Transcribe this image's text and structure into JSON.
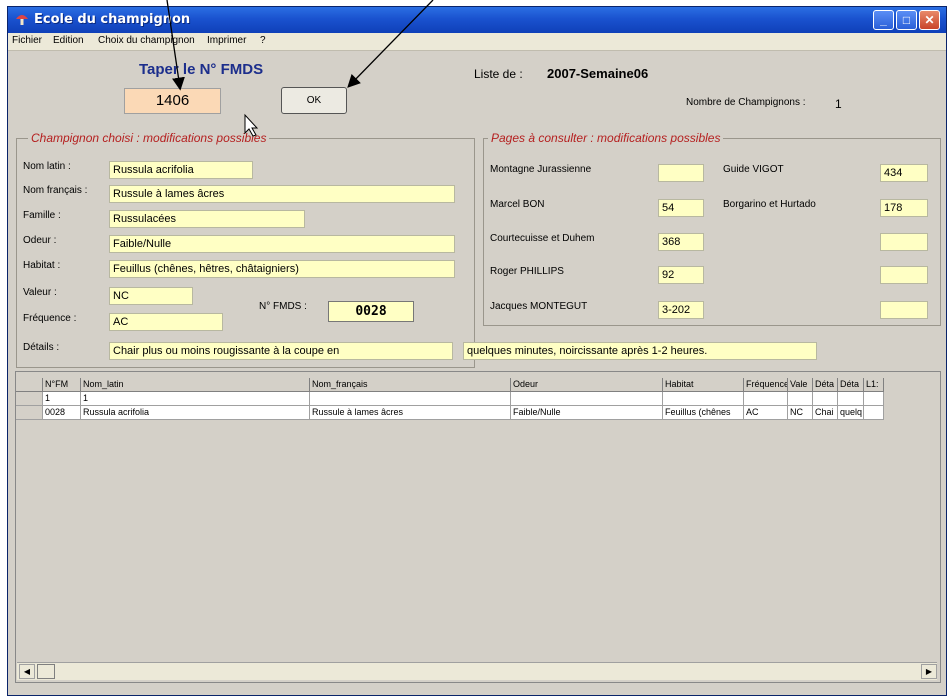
{
  "window": {
    "title": "Ecole du champignon"
  },
  "menu": [
    "Fichier",
    "Edition",
    "Choix du champignon",
    "Imprimer",
    "?"
  ],
  "search": {
    "label": "Taper le N° FMDS",
    "value": "1406",
    "ok": "OK"
  },
  "liste": {
    "label": "Liste de :",
    "value": "2007-Semaine06"
  },
  "count": {
    "label": "Nombre de Champignons :",
    "value": "1"
  },
  "left_panel": {
    "title": "Champignon choisi : modifications possibles",
    "fields": [
      {
        "label": "Nom latin :",
        "value": "Russula acrifolia"
      },
      {
        "label": "Nom français :",
        "value": "Russule à lames âcres"
      },
      {
        "label": "Famille :",
        "value": "Russulacées"
      },
      {
        "label": "Odeur :",
        "value": "Faible/Nulle"
      },
      {
        "label": "Habitat :",
        "value": "Feuillus (chênes, hêtres, châtaigniers)"
      },
      {
        "label": "Valeur :",
        "value": "NC"
      },
      {
        "label": "Fréquence :",
        "value": "AC"
      },
      {
        "label": "Détails :",
        "value": "Chair plus ou moins rougissante à la coupe en"
      }
    ],
    "details_cont": "quelques minutes, noircissante après 1-2 heures.",
    "fmds_label": "N° FMDS :",
    "fmds_value": "0028"
  },
  "right_panel": {
    "title": "Pages à consulter : modifications possibles",
    "left_books": [
      {
        "label": "Montagne Jurassienne",
        "value": ""
      },
      {
        "label": "Marcel BON",
        "value": "54"
      },
      {
        "label": "Courtecuisse et Duhem",
        "value": "368"
      },
      {
        "label": "Roger PHILLIPS",
        "value": "92"
      },
      {
        "label": "Jacques MONTEGUT",
        "value": "3-202"
      }
    ],
    "right_books": [
      {
        "label": "Guide VIGOT",
        "value": "434"
      },
      {
        "label": "Borgarino et Hurtado",
        "value": "178"
      },
      {
        "label": "",
        "value": ""
      },
      {
        "label": "",
        "value": ""
      },
      {
        "label": "",
        "value": ""
      }
    ]
  },
  "table": {
    "headers": [
      "N°FM",
      "Nom_latin",
      "Nom_français",
      "Odeur",
      "Habitat",
      "Fréquence",
      "Vale",
      "Déta",
      "Déta",
      "L1:"
    ],
    "rows": [
      [
        "1",
        "1",
        "",
        "",
        "",
        "",
        "",
        "",
        "",
        ""
      ],
      [
        "0028",
        "Russula acrifolia",
        "Russule à lames âcres",
        "Faible/Nulle",
        "Feuillus (chênes",
        "AC",
        "NC",
        "Chai",
        "quelq",
        ""
      ]
    ]
  }
}
